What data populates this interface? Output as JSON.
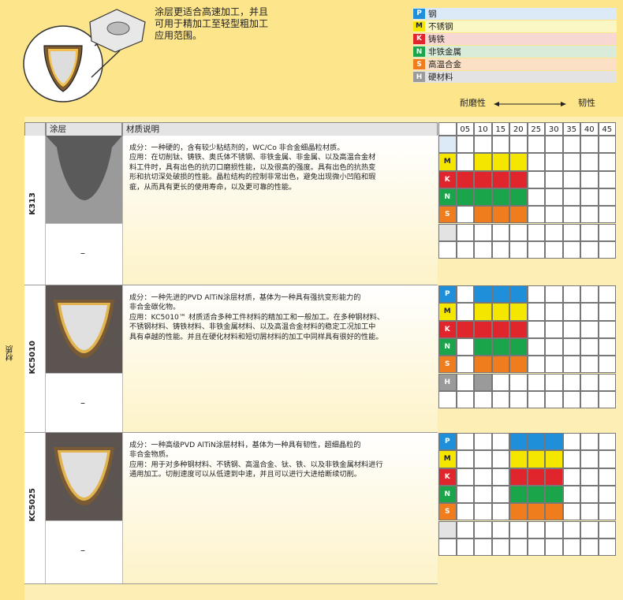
{
  "colors": {
    "P": "#1e8fd8",
    "M": "#f5e600",
    "K": "#e0252d",
    "N": "#1aa54a",
    "S": "#ef7d1e",
    "H": "#9a9a9a",
    "P_light": "#dce9f6",
    "M_light": "#fbf7c4",
    "K_light": "#f7d8d3",
    "N_light": "#d8ecd9",
    "S_light": "#fbe0c6",
    "H_light": "#e3e3e3"
  },
  "header": {
    "description": [
      "涂层更适合高速加工，并且",
      "可用于精加工至轻型粗加工",
      "应用范围。"
    ],
    "legend": [
      {
        "code": "P",
        "label": "钢"
      },
      {
        "code": "M",
        "label": "不锈钢"
      },
      {
        "code": "K",
        "label": "铸铁"
      },
      {
        "code": "N",
        "label": "非铁金属"
      },
      {
        "code": "S",
        "label": "高温合金"
      },
      {
        "code": "H",
        "label": "硬材料"
      }
    ],
    "wear_label": "耐磨性",
    "tough_label": "韧性"
  },
  "table": {
    "side_label": "材质",
    "col_coating": "涂层",
    "col_desc": "材质说明",
    "grades": [
      "05",
      "10",
      "15",
      "20",
      "25",
      "30",
      "35",
      "40",
      "45"
    ],
    "dash": "–",
    "sections": [
      {
        "name": "K313",
        "text": [
          "成分：一种硬的，含有较少粘结剂的，WC/Co 非合金细晶粒材质。",
          "应用：在切削钛、铸铁、奥氏体不锈钢、非铁金属、非金属、以及高温合金材",
          "料工件时，具有出色的抗刃口磨损性能，以及很高的强度。具有出色的抗热变",
          "形和抗切深处破损的性能。晶粒结构的控制非常出色，避免出现微小凹陷和瑕",
          "疵，从而具有更长的使用寿命，以及更可靠的性能。"
        ],
        "rows": [
          {
            "code": "P",
            "range": null
          },
          {
            "code": "M",
            "range": [
              1,
              3
            ]
          },
          {
            "code": "K",
            "range": [
              0,
              3
            ]
          },
          {
            "code": "N",
            "range": [
              0,
              3
            ]
          },
          {
            "code": "S",
            "range": [
              1,
              3
            ]
          },
          {
            "code": "H",
            "range": null
          }
        ]
      },
      {
        "name": "KC5010",
        "text": [
          "成分：一种先进的PVD AlTiN涂层材质，基体为一种具有强抗变形能力的",
          "非合金碳化物。",
          "应用：KC5010™ 材质适合多种工件材料的精加工和一般加工。在多种钢材料、",
          "不锈钢材料、铸铁材料、非铁金属材料、以及高温合金材料的稳定工况加工中",
          "具有卓越的性能。并且在硬化材料和短切屑材料的加工中同样具有很好的性能。"
        ],
        "rows": [
          {
            "code": "P",
            "range": [
              1,
              3
            ]
          },
          {
            "code": "M",
            "range": [
              1,
              3
            ]
          },
          {
            "code": "K",
            "range": [
              0,
              3
            ]
          },
          {
            "code": "N",
            "range": [
              1,
              3
            ]
          },
          {
            "code": "S",
            "range": [
              1,
              3
            ]
          },
          {
            "code": "H",
            "range": [
              1,
              1
            ]
          }
        ]
      },
      {
        "name": "KC5025",
        "text": [
          "成分：一种高级PVD AlTiN涂层材料，基体为一种具有韧性，超细晶粒的",
          "非合金物质。",
          "应用：用于对多种钢材料、不锈钢、高温合金、钛、铁、以及非铁金属材料进行",
          "通用加工。切削速度可以从低速到中速，并且可以进行大进给断续切削。"
        ],
        "rows": [
          {
            "code": "P",
            "range": [
              3,
              5
            ]
          },
          {
            "code": "M",
            "range": [
              3,
              5
            ]
          },
          {
            "code": "K",
            "range": [
              3,
              5
            ]
          },
          {
            "code": "N",
            "range": [
              3,
              5
            ]
          },
          {
            "code": "S",
            "range": [
              3,
              5
            ]
          },
          {
            "code": "H",
            "range": null
          }
        ]
      }
    ]
  }
}
